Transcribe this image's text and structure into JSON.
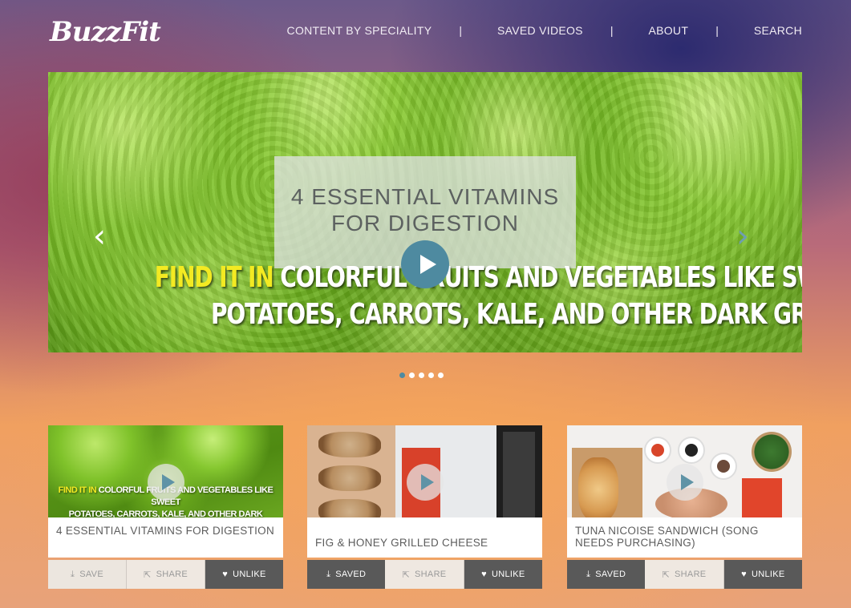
{
  "brand": {
    "logo_text": "BuzzFit"
  },
  "nav": {
    "items": [
      "CONTENT BY SPECIALITY",
      "SAVED VIDEOS",
      "ABOUT",
      "SEARCH"
    ],
    "separator": "|"
  },
  "hero": {
    "title": "4 ESSENTIAL VITAMINS FOR DIGESTION",
    "overlay_highlight": "FIND IT IN",
    "overlay_line1": " COLORFUL FRUITS AND VEGETABLES LIKE SWEET",
    "overlay_line2": "POTATOES, CARROTS, KALE, AND OTHER DARK GREENS",
    "prev_icon": "chevron-left-icon",
    "next_icon": "chevron-right-icon",
    "slides": 5,
    "active_slide": 1
  },
  "cards": [
    {
      "title": "4 ESSENTIAL VITAMINS FOR DIGESTION",
      "thumb_highlight": "FIND IT IN",
      "thumb_line1": " COLORFUL FRUITS AND VEGETABLES LIKE SWEET",
      "thumb_line2": "POTATOES, CARROTS, KALE, AND OTHER DARK GREENS",
      "save_label": "SAVE",
      "share_label": "SHARE",
      "like_label": "UNLIKE"
    },
    {
      "title": "FIG & HONEY GRILLED CHEESE",
      "save_label": "SAVED",
      "share_label": "SHARE",
      "like_label": "UNLIKE"
    },
    {
      "title": "TUNA NICOISE SANDWICH (SONG NEEDS PURCHASING)",
      "save_label": "SAVED",
      "share_label": "SHARE",
      "like_label": "UNLIKE"
    }
  ],
  "colors": {
    "accent": "#4e8aa0",
    "button_dark": "#595959",
    "highlight": "#f3ea22"
  }
}
